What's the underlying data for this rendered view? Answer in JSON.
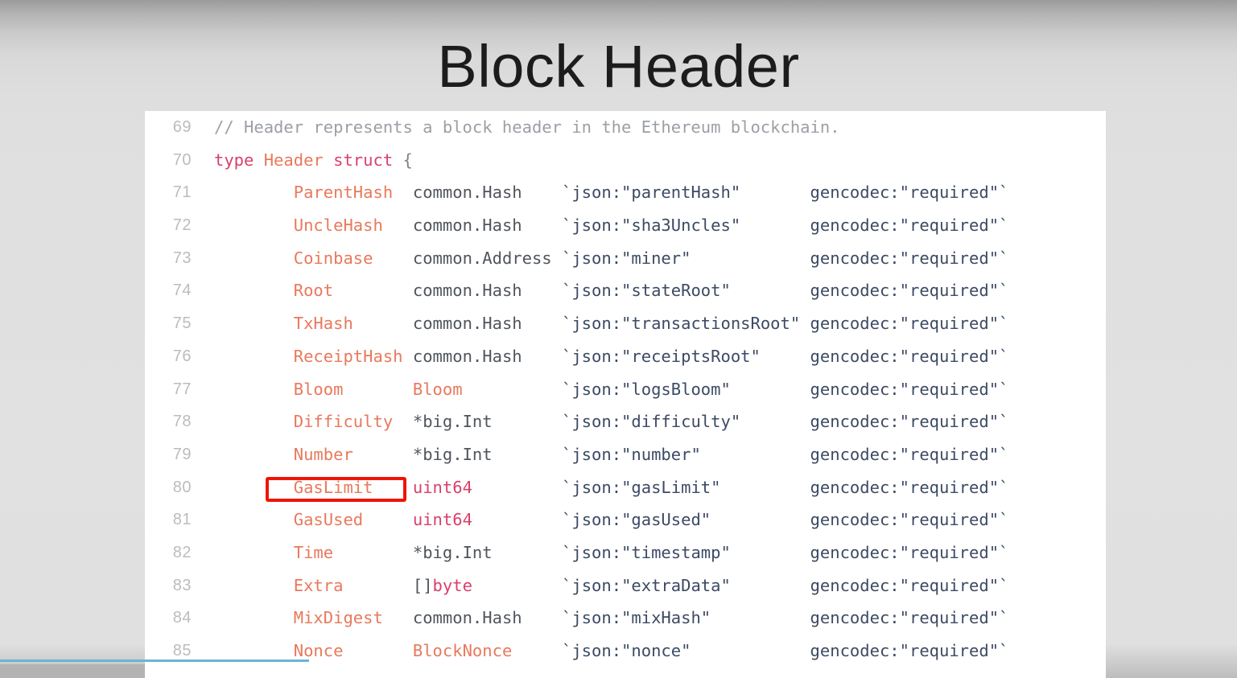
{
  "slide": {
    "title": "Block Header",
    "background_top_color": "#9b9b9b",
    "background_bottom_color": "#e0e0e0"
  },
  "highlight": {
    "target_field": "GasLimit",
    "color": "#f01405"
  },
  "progress": {
    "accent_color": "#6ab4d8",
    "percent": 25
  },
  "code": {
    "language": "Go",
    "panel_background": "#ffffff",
    "lines": [
      {
        "number": "69",
        "tokens": [
          {
            "text": "// Header represents a block header in the Ethereum blockchain.",
            "cls": "t-comment"
          }
        ]
      },
      {
        "number": "70",
        "tokens": [
          {
            "text": "type ",
            "cls": "t-kw"
          },
          {
            "text": "Header ",
            "cls": "t-name"
          },
          {
            "text": "struct ",
            "cls": "t-kw"
          },
          {
            "text": "{",
            "cls": "t-brace"
          }
        ]
      },
      {
        "number": "71",
        "tokens": [
          {
            "text": "        ",
            "cls": "t-plain"
          },
          {
            "text": "ParentHash  ",
            "cls": "t-name"
          },
          {
            "text": "common.Hash    ",
            "cls": "t-plain"
          },
          {
            "text": "`json:\"parentHash\"       gencodec:\"required\"`",
            "cls": "t-tag"
          }
        ]
      },
      {
        "number": "72",
        "tokens": [
          {
            "text": "        ",
            "cls": "t-plain"
          },
          {
            "text": "UncleHash   ",
            "cls": "t-name"
          },
          {
            "text": "common.Hash    ",
            "cls": "t-plain"
          },
          {
            "text": "`json:\"sha3Uncles\"       gencodec:\"required\"`",
            "cls": "t-tag"
          }
        ]
      },
      {
        "number": "73",
        "tokens": [
          {
            "text": "        ",
            "cls": "t-plain"
          },
          {
            "text": "Coinbase    ",
            "cls": "t-name"
          },
          {
            "text": "common.Address ",
            "cls": "t-plain"
          },
          {
            "text": "`json:\"miner\"            gencodec:\"required\"`",
            "cls": "t-tag"
          }
        ]
      },
      {
        "number": "74",
        "tokens": [
          {
            "text": "        ",
            "cls": "t-plain"
          },
          {
            "text": "Root        ",
            "cls": "t-name"
          },
          {
            "text": "common.Hash    ",
            "cls": "t-plain"
          },
          {
            "text": "`json:\"stateRoot\"        gencodec:\"required\"`",
            "cls": "t-tag"
          }
        ]
      },
      {
        "number": "75",
        "tokens": [
          {
            "text": "        ",
            "cls": "t-plain"
          },
          {
            "text": "TxHash      ",
            "cls": "t-name"
          },
          {
            "text": "common.Hash    ",
            "cls": "t-plain"
          },
          {
            "text": "`json:\"transactionsRoot\" gencodec:\"required\"`",
            "cls": "t-tag"
          }
        ]
      },
      {
        "number": "76",
        "tokens": [
          {
            "text": "        ",
            "cls": "t-plain"
          },
          {
            "text": "ReceiptHash ",
            "cls": "t-name"
          },
          {
            "text": "common.Hash    ",
            "cls": "t-plain"
          },
          {
            "text": "`json:\"receiptsRoot\"     gencodec:\"required\"`",
            "cls": "t-tag"
          }
        ]
      },
      {
        "number": "77",
        "tokens": [
          {
            "text": "        ",
            "cls": "t-plain"
          },
          {
            "text": "Bloom       ",
            "cls": "t-name"
          },
          {
            "text": "Bloom",
            "cls": "t-type"
          },
          {
            "text": "          ",
            "cls": "t-plain"
          },
          {
            "text": "`json:\"logsBloom\"        gencodec:\"required\"`",
            "cls": "t-tag"
          }
        ]
      },
      {
        "number": "78",
        "tokens": [
          {
            "text": "        ",
            "cls": "t-plain"
          },
          {
            "text": "Difficulty  ",
            "cls": "t-name"
          },
          {
            "text": "*big.Int       ",
            "cls": "t-plain"
          },
          {
            "text": "`json:\"difficulty\"       gencodec:\"required\"`",
            "cls": "t-tag"
          }
        ]
      },
      {
        "number": "79",
        "tokens": [
          {
            "text": "        ",
            "cls": "t-plain"
          },
          {
            "text": "Number      ",
            "cls": "t-name"
          },
          {
            "text": "*big.Int       ",
            "cls": "t-plain"
          },
          {
            "text": "`json:\"number\"           gencodec:\"required\"`",
            "cls": "t-tag"
          }
        ]
      },
      {
        "number": "80",
        "tokens": [
          {
            "text": "        ",
            "cls": "t-plain"
          },
          {
            "text": "GasLimit    ",
            "cls": "t-name"
          },
          {
            "text": "uint64",
            "cls": "t-kw"
          },
          {
            "text": "         ",
            "cls": "t-plain"
          },
          {
            "text": "`json:\"gasLimit\"         gencodec:\"required\"`",
            "cls": "t-tag"
          }
        ]
      },
      {
        "number": "81",
        "tokens": [
          {
            "text": "        ",
            "cls": "t-plain"
          },
          {
            "text": "GasUsed     ",
            "cls": "t-name"
          },
          {
            "text": "uint64",
            "cls": "t-kw"
          },
          {
            "text": "         ",
            "cls": "t-plain"
          },
          {
            "text": "`json:\"gasUsed\"          gencodec:\"required\"`",
            "cls": "t-tag"
          }
        ]
      },
      {
        "number": "82",
        "tokens": [
          {
            "text": "        ",
            "cls": "t-plain"
          },
          {
            "text": "Time        ",
            "cls": "t-name"
          },
          {
            "text": "*big.Int       ",
            "cls": "t-plain"
          },
          {
            "text": "`json:\"timestamp\"        gencodec:\"required\"`",
            "cls": "t-tag"
          }
        ]
      },
      {
        "number": "83",
        "tokens": [
          {
            "text": "        ",
            "cls": "t-plain"
          },
          {
            "text": "Extra       ",
            "cls": "t-name"
          },
          {
            "text": "[]",
            "cls": "t-plain"
          },
          {
            "text": "byte",
            "cls": "t-kw"
          },
          {
            "text": "         ",
            "cls": "t-plain"
          },
          {
            "text": "`json:\"extraData\"        gencodec:\"required\"`",
            "cls": "t-tag"
          }
        ]
      },
      {
        "number": "84",
        "tokens": [
          {
            "text": "        ",
            "cls": "t-plain"
          },
          {
            "text": "MixDigest   ",
            "cls": "t-name"
          },
          {
            "text": "common.Hash    ",
            "cls": "t-plain"
          },
          {
            "text": "`json:\"mixHash\"          gencodec:\"required\"`",
            "cls": "t-tag"
          }
        ]
      },
      {
        "number": "85",
        "tokens": [
          {
            "text": "        ",
            "cls": "t-plain"
          },
          {
            "text": "Nonce       ",
            "cls": "t-name"
          },
          {
            "text": "BlockNonce",
            "cls": "t-type"
          },
          {
            "text": "     ",
            "cls": "t-plain"
          },
          {
            "text": "`json:\"nonce\"            gencodec:\"required\"`",
            "cls": "t-tag"
          }
        ]
      }
    ]
  }
}
